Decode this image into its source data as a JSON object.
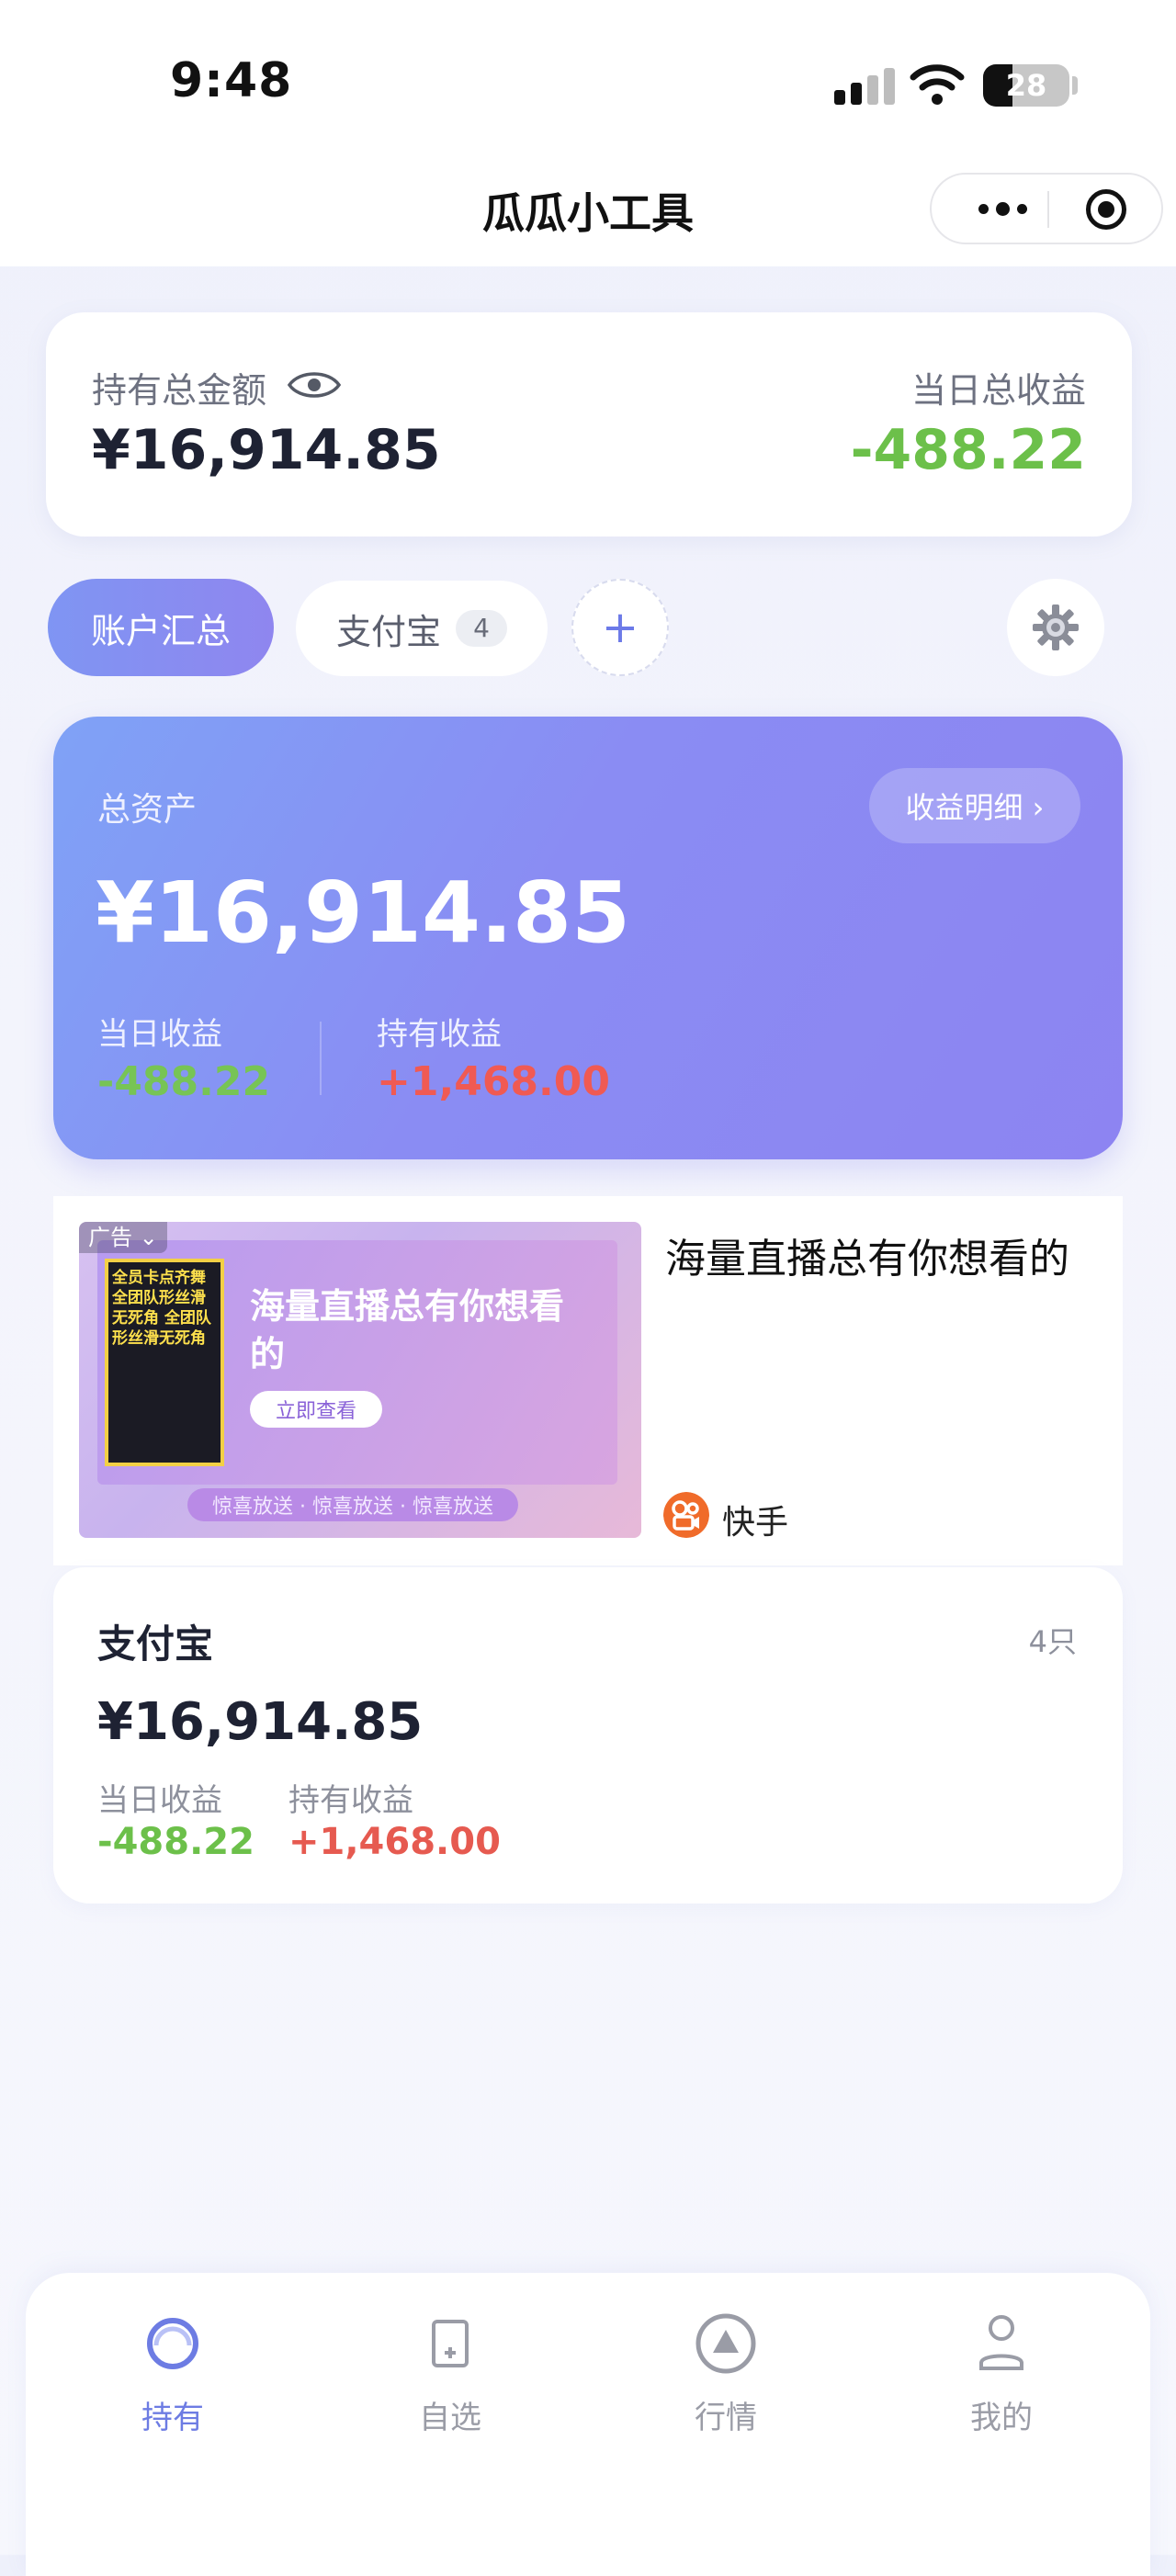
{
  "status_bar": {
    "time": "9:48",
    "battery": "28"
  },
  "nav": {
    "title": "瓜瓜小工具"
  },
  "summary": {
    "total_label": "持有总金额",
    "total_value": "¥16,914.85",
    "day_label": "当日总收益",
    "day_value": "-488.22"
  },
  "tabs": {
    "active": "账户汇总",
    "alipay": "支付宝",
    "alipay_count": "4",
    "add": "+"
  },
  "asset_card": {
    "label": "总资产",
    "detail_button": "收益明细 ›",
    "value": "¥16,914.85",
    "day_label": "当日收益",
    "day_value": "-488.22",
    "hold_label": "持有收益",
    "hold_value": "+1,468.00"
  },
  "ad": {
    "tag": "广告 ⌄",
    "poster_text": "全员卡点齐舞 全团队形丝滑无死角 全团队形丝滑无死角",
    "headline": "海量直播总有你想看的",
    "watch_button": "立即查看",
    "ribbon": "惊喜放送 · 惊喜放送 · 惊喜放送",
    "title": "海量直播总有你想看的",
    "advertiser": "快手"
  },
  "account": {
    "name": "支付宝",
    "count": "4只",
    "value": "¥16,914.85",
    "day_label": "当日收益",
    "day_value": "-488.22",
    "hold_label": "持有收益",
    "hold_value": "+1,468.00"
  },
  "tabbar": {
    "items": [
      {
        "label": "持有",
        "icon": "holdings-icon"
      },
      {
        "label": "自选",
        "icon": "watchlist-icon"
      },
      {
        "label": "行情",
        "icon": "market-icon"
      },
      {
        "label": "我的",
        "icon": "profile-icon"
      }
    ]
  },
  "colors": {
    "accent": "#6d7ce3",
    "gain_green": "#6cc04a",
    "loss_red": "#e65a50"
  }
}
